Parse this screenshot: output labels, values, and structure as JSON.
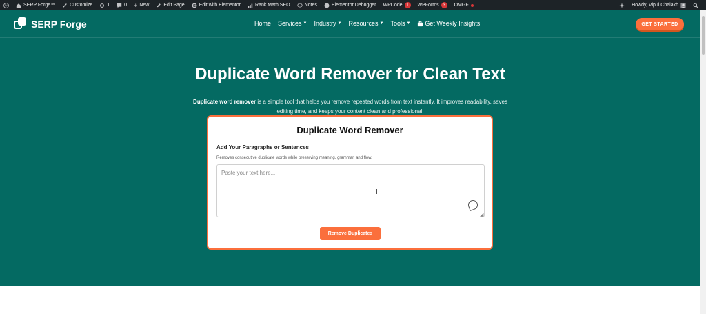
{
  "adminbar": {
    "site_name": "SERP Forge™",
    "customize": "Customize",
    "updates_count": "1",
    "comments_count": "0",
    "new": "New",
    "edit_page": "Edit Page",
    "edit_elementor": "Edit with Elementor",
    "rank_math": "Rank Math SEO",
    "notes": "Notes",
    "elementor_debugger": "Elementor Debugger",
    "wpcode": "WPCode",
    "wpcode_badge": "1",
    "wpforms": "WPForms",
    "wpforms_badge": "3",
    "omgf": "OMGF",
    "howdy": "Howdy, Vipul Chalakh"
  },
  "header": {
    "logo_text": "SERP Forge",
    "nav": [
      {
        "label": "Home",
        "caret": false
      },
      {
        "label": "Services",
        "caret": true
      },
      {
        "label": "Industry",
        "caret": true
      },
      {
        "label": "Resources",
        "caret": true
      },
      {
        "label": "Tools",
        "caret": true
      },
      {
        "label": "Get Weekly Insights",
        "caret": false
      }
    ],
    "cta": "GET STARTED"
  },
  "hero": {
    "title": "Duplicate Word Remover for Clean Text",
    "desc_bold": "Duplicate word remover",
    "desc_rest": " is a simple tool that helps you remove repeated words from text instantly. It improves readability, saves editing time, and keeps your content clean and professional."
  },
  "tool": {
    "title": "Duplicate Word Remover",
    "label": "Add Your Paragraphs or Sentences",
    "help": "Removes consecutive duplicate words while preserving meaning, grammar, and flow.",
    "placeholder": "Paste your text here...",
    "button": "Remove Duplicates"
  },
  "colors": {
    "teal": "#046a62",
    "orange": "#fb6f3c",
    "adminbar": "#1d2327"
  }
}
